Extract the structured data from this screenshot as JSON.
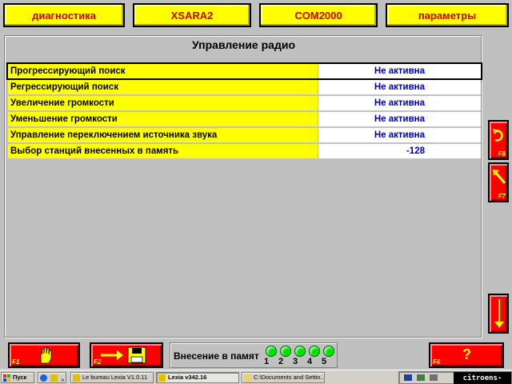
{
  "top_tabs": [
    "диагностика",
    "XSARA2",
    "COM2000",
    "параметры"
  ],
  "panel": {
    "title": "Управление радио",
    "rows": [
      {
        "label": "Прогрессирующий поиск",
        "value": "Не активна"
      },
      {
        "label": "Регрессирующий поиск",
        "value": "Не активна"
      },
      {
        "label": "Увеличение громкости",
        "value": "Не активна"
      },
      {
        "label": "Уменьшение громкости",
        "value": "Не активна"
      },
      {
        "label": "Управление переключением источника звука",
        "value": "Не активна"
      },
      {
        "label": "Выбор станций внесенных в память",
        "value": "-128"
      }
    ]
  },
  "side_buttons": {
    "f9": "F9",
    "f7": "F7"
  },
  "bottom": {
    "f1": "F1",
    "f2": "F2",
    "f6": "F6",
    "help_glyph": "?",
    "memory_label": "Внесение в памят",
    "memory_slots": [
      "1",
      "2",
      "3",
      "4",
      "5"
    ]
  },
  "taskbar": {
    "start": "Пуск",
    "items": [
      "Le bureau Lexia V1.0.11",
      "Lexia v342.16",
      "C:\\Documents and Settin..."
    ],
    "tray_text": "citroens-club.ru"
  },
  "colors": {
    "tab_yellow": "#ffff00",
    "tab_text": "#d00000",
    "value_blue": "#0000b0",
    "button_red": "#ff0000",
    "led_green": "#00e000"
  }
}
